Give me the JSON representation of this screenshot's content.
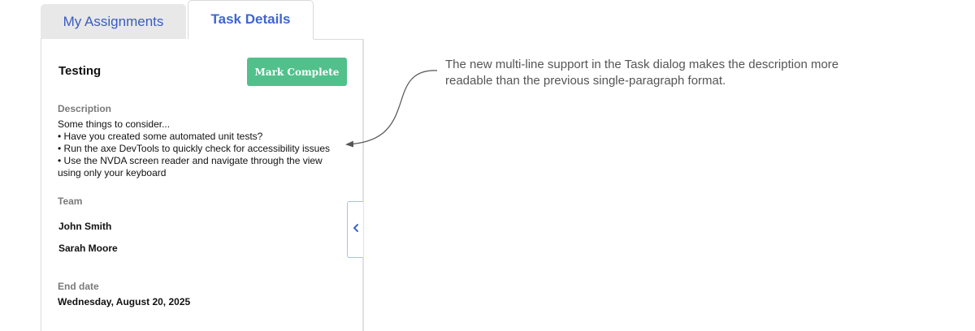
{
  "tabs": [
    {
      "label": "My Assignments",
      "active": false
    },
    {
      "label": "Task Details",
      "active": true
    }
  ],
  "task": {
    "title": "Testing",
    "complete_button_label": "Mark Complete",
    "description_label": "Description",
    "description_lines": [
      "Some things to consider...",
      "• Have you created some automated unit tests?",
      "• Run the axe DevTools to quickly check for accessibility issues",
      "• Use the NVDA screen reader and navigate through the view using only your keyboard"
    ],
    "team_label": "Team",
    "team_members": [
      "John Smith",
      "Sarah Moore"
    ],
    "end_date_label": "End date",
    "end_date": "Wednesday, August 20, 2025"
  },
  "annotation": {
    "text": "The new multi-line support in the Task dialog makes the description more readable than the previous single-paragraph format."
  },
  "colors": {
    "accent": "#3f66d0",
    "complete_button": "#52c08b",
    "inactive_tab_bg": "#e8e8e8"
  },
  "icons": {
    "collapse": "chevron-left-icon"
  }
}
